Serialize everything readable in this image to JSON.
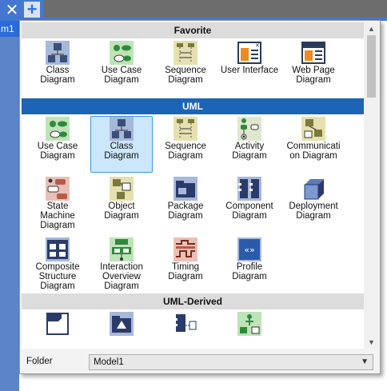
{
  "topbar": {
    "close_glyph": "✕",
    "plus_glyph": "+",
    "doc_tab": "m1"
  },
  "sections": [
    {
      "title": "Favorite",
      "selected": false,
      "items": [
        {
          "label": "Class\nDiagram",
          "icon": "class-diagram-icon"
        },
        {
          "label": "Use Case\nDiagram",
          "icon": "use-case-diagram-icon"
        },
        {
          "label": "Sequence\nDiagram",
          "icon": "sequence-diagram-icon"
        },
        {
          "label": "User Interface",
          "icon": "user-interface-icon"
        },
        {
          "label": "Web Page\nDiagram",
          "icon": "web-page-diagram-icon"
        }
      ]
    },
    {
      "title": "UML",
      "selected": true,
      "items": [
        {
          "label": "Use Case\nDiagram",
          "icon": "use-case-diagram-icon"
        },
        {
          "label": "Class\nDiagram",
          "icon": "class-diagram-icon",
          "selected": true
        },
        {
          "label": "Sequence\nDiagram",
          "icon": "sequence-diagram-icon"
        },
        {
          "label": "Activity\nDiagram",
          "icon": "activity-diagram-icon"
        },
        {
          "label": "Communicati\non Diagram",
          "icon": "communication-diagram-icon"
        },
        {
          "label": "State\nMachine\nDiagram",
          "icon": "state-machine-diagram-icon"
        },
        {
          "label": "Object\nDiagram",
          "icon": "object-diagram-icon"
        },
        {
          "label": "Package\nDiagram",
          "icon": "package-diagram-icon"
        },
        {
          "label": "Component\nDiagram",
          "icon": "component-diagram-icon"
        },
        {
          "label": "Deployment\nDiagram",
          "icon": "deployment-diagram-icon"
        },
        {
          "label": "Composite\nStructure\nDiagram",
          "icon": "composite-structure-diagram-icon"
        },
        {
          "label": "Interaction\nOverview\nDiagram",
          "icon": "interaction-overview-diagram-icon"
        },
        {
          "label": "Timing\nDiagram",
          "icon": "timing-diagram-icon"
        },
        {
          "label": "Profile\nDiagram",
          "icon": "profile-diagram-icon"
        }
      ]
    },
    {
      "title": "UML-Derived",
      "selected": false,
      "items": [
        {
          "label": "",
          "icon": "frame-diagram-icon"
        },
        {
          "label": "",
          "icon": "model-diagram-icon"
        },
        {
          "label": "",
          "icon": "component-interface-icon"
        },
        {
          "label": "",
          "icon": "information-flow-icon"
        }
      ]
    }
  ],
  "folder": {
    "label": "Folder",
    "value": "Model1"
  },
  "scrollbar": {
    "up_glyph": "▲",
    "down_glyph": "▼"
  },
  "colors": {
    "accent": "#1c64b6",
    "selection": "#cce6fb",
    "tab_bar": "#4477d2"
  }
}
